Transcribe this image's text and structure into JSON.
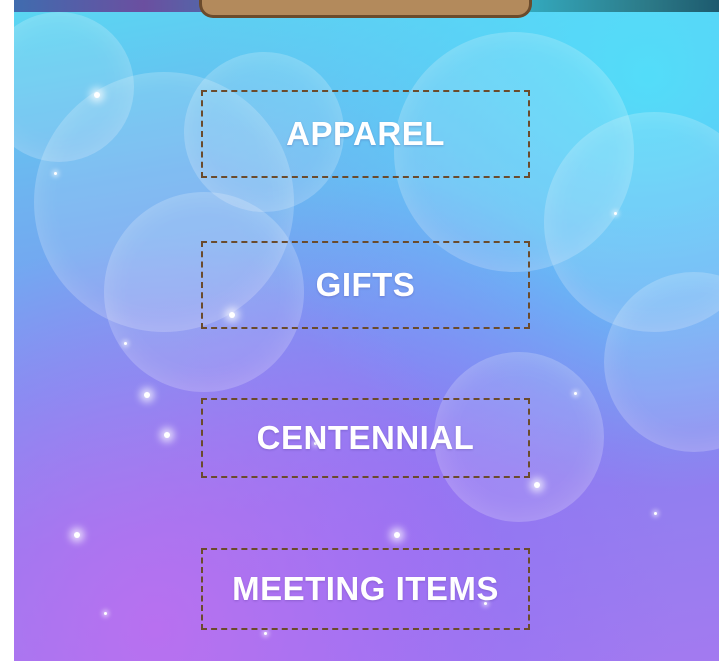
{
  "menu": {
    "items": [
      {
        "label": "APPAREL"
      },
      {
        "label": "GIFTS"
      },
      {
        "label": "CENTENNIAL"
      },
      {
        "label": "MEETING ITEMS"
      }
    ]
  },
  "colors": {
    "border": "#6b4b2c",
    "tab": "#b38a5c",
    "text": "#ffffff"
  }
}
